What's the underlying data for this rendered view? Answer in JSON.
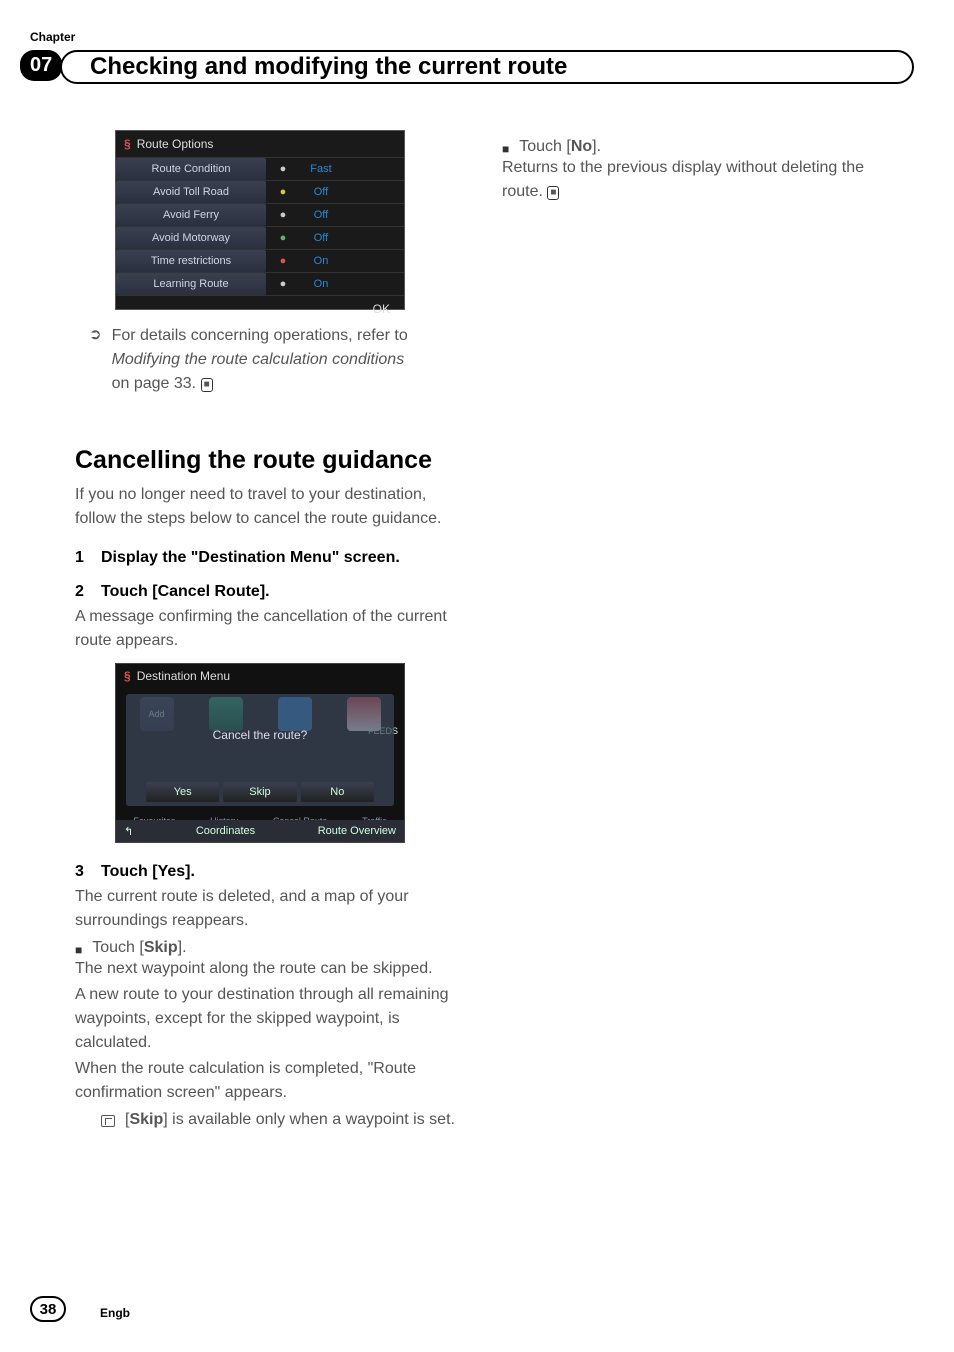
{
  "chapter": {
    "label": "Chapter",
    "number": "07"
  },
  "page_title": "Checking and modifying the current route",
  "route_options": {
    "header": "Route Options",
    "rows": [
      {
        "label": "Route Condition",
        "icon": "blue-car-icon",
        "iconClass": "icon-white",
        "value": "Fast"
      },
      {
        "label": "Avoid Toll Road",
        "icon": "coin-icon",
        "iconClass": "icon-yellow",
        "value": "Off"
      },
      {
        "label": "Avoid Ferry",
        "icon": "ferry-icon",
        "iconClass": "icon-white",
        "value": "Off"
      },
      {
        "label": "Avoid Motorway",
        "icon": "motorway-icon",
        "iconClass": "icon-green",
        "value": "Off"
      },
      {
        "label": "Time restrictions",
        "icon": "clock-icon",
        "iconClass": "icon-red",
        "value": "On"
      },
      {
        "label": "Learning Route",
        "icon": "chart-icon",
        "iconClass": "icon-white",
        "value": "On"
      }
    ],
    "ok": "OK"
  },
  "ref": {
    "lead": "For details concerning operations, refer to",
    "italic": "Modifying the route calculation conditions",
    "tail": "on page 33."
  },
  "section2": {
    "heading": "Cancelling the route guidance",
    "intro": "If you no longer need to travel to your destination, follow the steps below to cancel the route guidance.",
    "steps": [
      {
        "num": "1",
        "title": "Display the \"Destination Menu\" screen."
      },
      {
        "num": "2",
        "title": "Touch [Cancel Route]."
      }
    ],
    "step2_body": "A message confirming the cancellation of the current route appears.",
    "dest_menu": {
      "header": "Destination Menu",
      "tiles": {
        "add": "Add",
        "feeds": "FEEDS"
      },
      "prompt": "Cancel the route?",
      "buttons": {
        "yes": "Yes",
        "skip": "Skip",
        "no": "No"
      },
      "bottom": [
        "Favourites",
        "History",
        "Cancel Route",
        "Traffic"
      ],
      "footer": {
        "back": "↰",
        "coords": "Coordinates",
        "overview": "Route Overview"
      }
    },
    "step3": {
      "num": "3",
      "title": "Touch [Yes]."
    },
    "step3_body": "The current route is deleted, and a map of your surroundings reappears.",
    "skip_bullet": "Touch [",
    "skip_bold": "Skip",
    "skip_bullet_tail": "].",
    "skip_body": "The next waypoint along the route can be skipped.",
    "skip_body2": "A new route to your destination through all remaining waypoints, except for the skipped waypoint, is calculated.",
    "skip_body3": "When the route calculation is completed, \"Route confirmation screen\" appears.",
    "skip_note_lead": "[",
    "skip_note_bold": "Skip",
    "skip_note_tail": "] is available only when a waypoint is set."
  },
  "col2": {
    "no_bullet_lead": "Touch [",
    "no_bold": "No",
    "no_bullet_tail": "].",
    "no_body": "Returns to the previous display without deleting the route."
  },
  "footer": {
    "page": "38",
    "lang": "Engb"
  }
}
